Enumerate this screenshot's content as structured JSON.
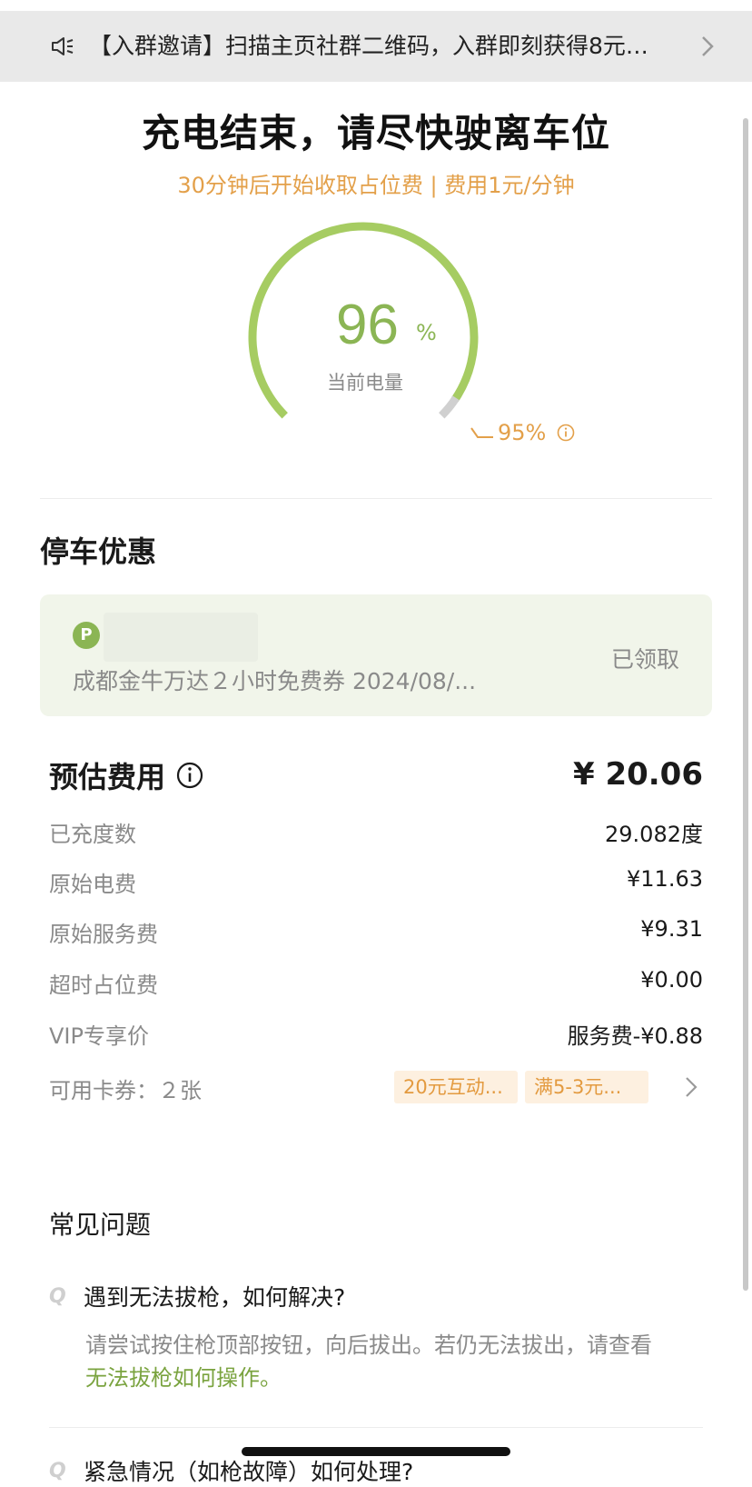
{
  "notice": {
    "text": "【入群邀请】扫描主页社群二维码，入群即刻获得8元…"
  },
  "status": {
    "title": "充电结束，请尽快驶离车位",
    "subtitle": "30分钟后开始收取占位费 | 费用1元/分钟"
  },
  "gauge": {
    "level_percent": 96,
    "value": "96",
    "unit": "%",
    "label": "当前电量",
    "limit_text": "95%",
    "arc_color": "#a6cc62",
    "limit_marker_color": "#d0d0d0"
  },
  "parking": {
    "section_title": "停车优惠",
    "badge": "P",
    "coupon_text": "成都金牛万达２小时免费券 2024/08/...",
    "status": "已领取"
  },
  "fees": {
    "title": "预估费用",
    "total": "¥ 20.06",
    "rows": [
      {
        "label": "已充度数",
        "value": "29.082度"
      },
      {
        "label": "原始电费",
        "value": "¥11.63"
      },
      {
        "label": "原始服务费",
        "value": "¥9.31"
      },
      {
        "label": "超时占位费",
        "value": "¥0.00"
      },
      {
        "label": "VIP专享价",
        "value": "服务费-¥0.88"
      }
    ],
    "cards_label": "可用卡券：２张",
    "card_tags": [
      "20元互动...",
      "满5-3元..."
    ]
  },
  "faq": {
    "title": "常见问题",
    "q_mark": "Q",
    "q1": "遇到无法拔枪，如何解决?",
    "a1": "请尝试按住枪顶部按钮，向后拔出。若仍无法拔出，请查看",
    "a1_link": "无法拔枪如何操作。",
    "q2": "紧急情况（如枪故障）如何处理?"
  },
  "colors": {
    "accent_green": "#8bb554",
    "accent_orange": "#e3a04a"
  }
}
